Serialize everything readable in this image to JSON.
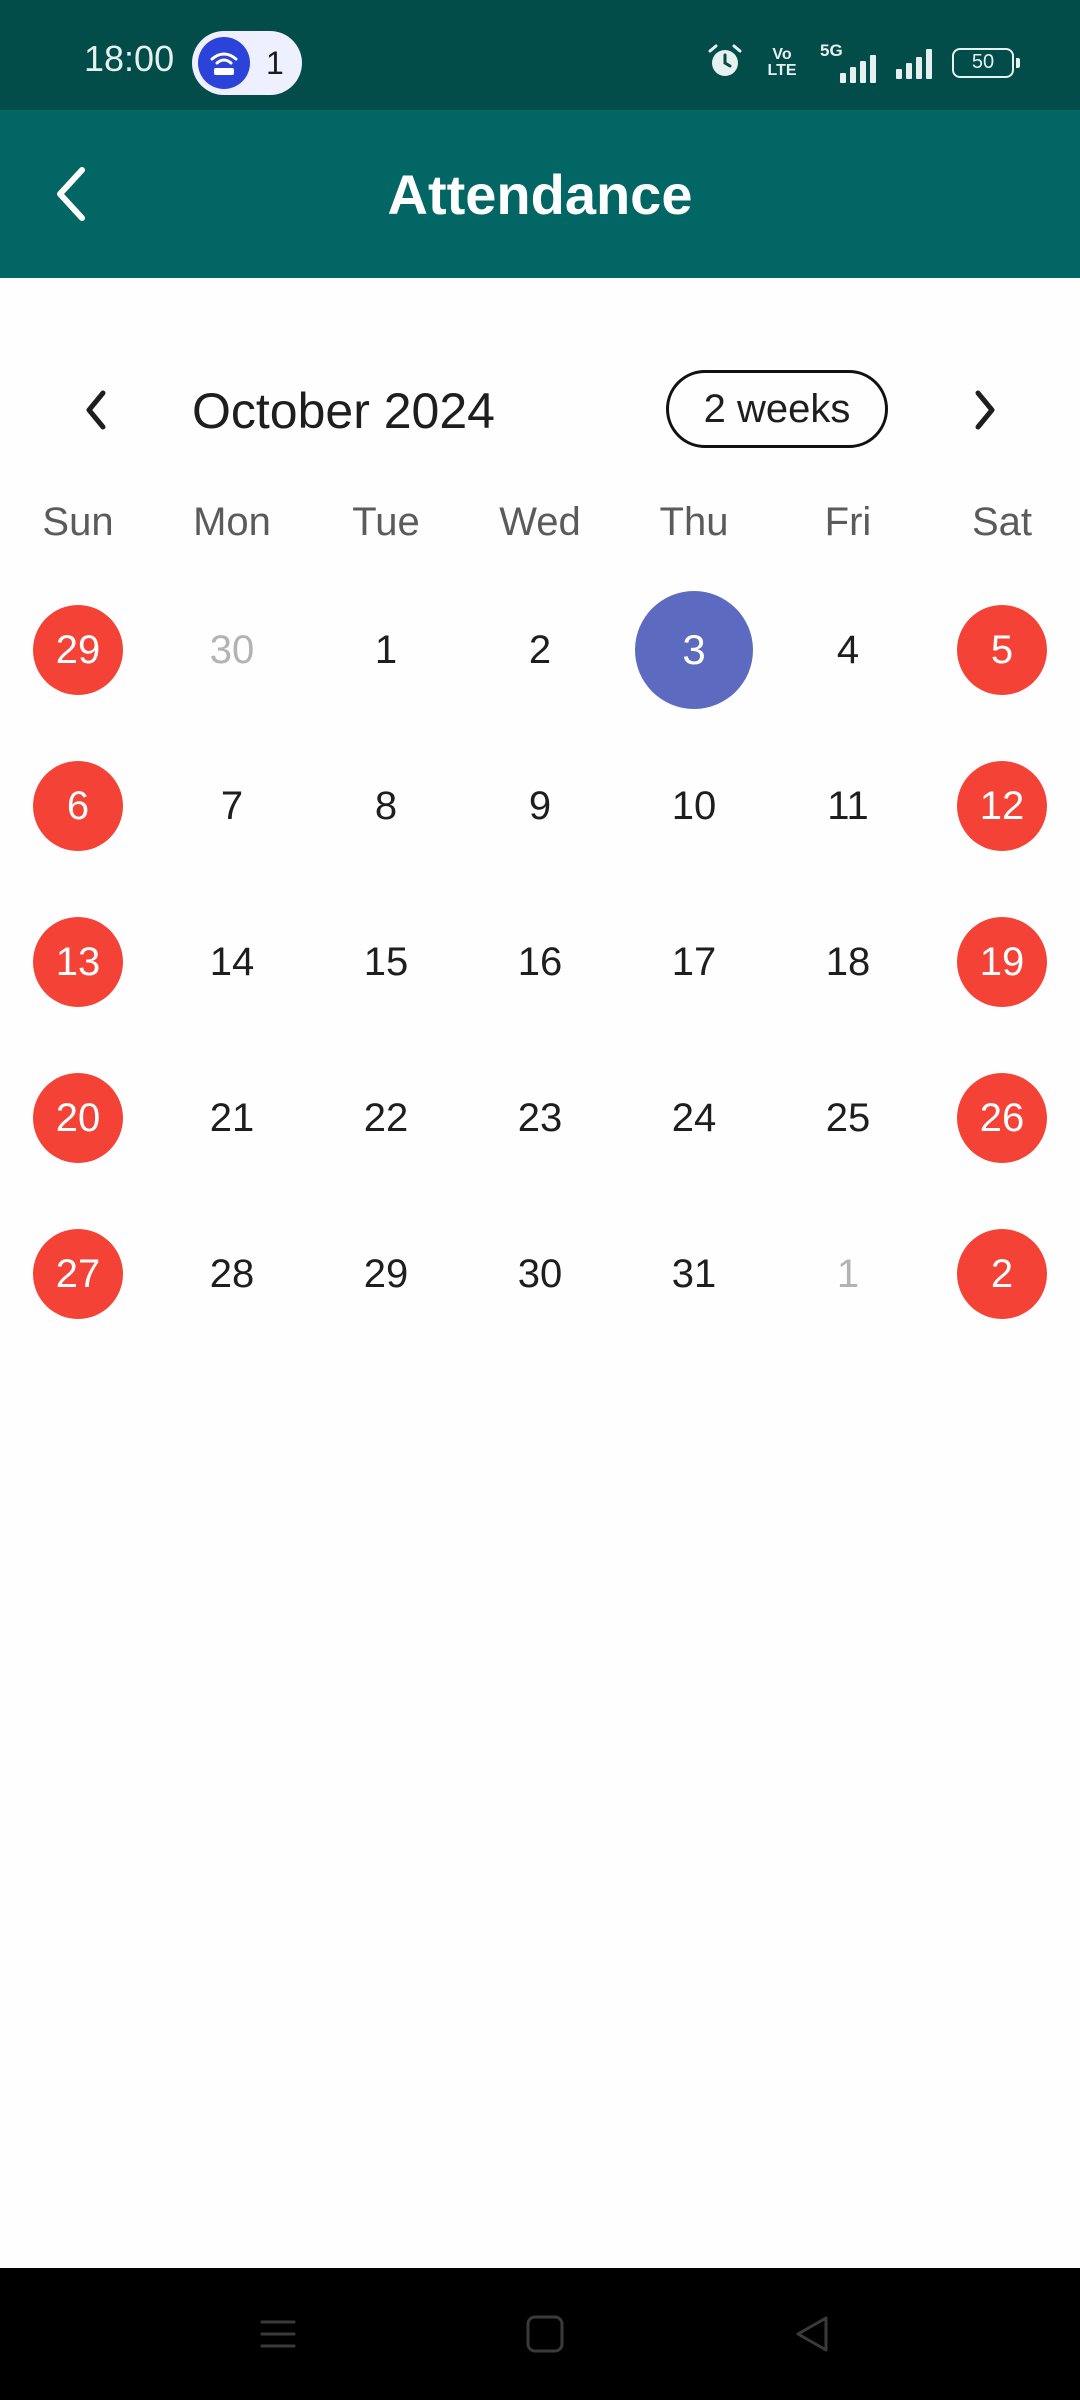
{
  "status_bar": {
    "time": "18:00",
    "hotspot_count": "1",
    "volte_top": "Vo",
    "volte_bottom": "LTE",
    "network_type": "5G",
    "battery": "50",
    "icons": [
      "hotspot-icon",
      "alarm-icon",
      "volte-icon",
      "signal-5g-icon",
      "signal-icon",
      "battery-icon"
    ]
  },
  "app_bar": {
    "title": "Attendance",
    "back_icon": "chevron-left-icon"
  },
  "calendar": {
    "month_title": "October 2024",
    "format_button": "2 weeks",
    "weekdays": [
      "Sun",
      "Mon",
      "Tue",
      "Wed",
      "Thu",
      "Fri",
      "Sat"
    ],
    "weeks": [
      [
        {
          "label": "29",
          "state": "holiday"
        },
        {
          "label": "30",
          "state": "outside"
        },
        {
          "label": "1",
          "state": "normal"
        },
        {
          "label": "2",
          "state": "normal"
        },
        {
          "label": "3",
          "state": "selected"
        },
        {
          "label": "4",
          "state": "normal"
        },
        {
          "label": "5",
          "state": "holiday"
        }
      ],
      [
        {
          "label": "6",
          "state": "holiday"
        },
        {
          "label": "7",
          "state": "normal"
        },
        {
          "label": "8",
          "state": "normal"
        },
        {
          "label": "9",
          "state": "normal"
        },
        {
          "label": "10",
          "state": "normal"
        },
        {
          "label": "11",
          "state": "normal"
        },
        {
          "label": "12",
          "state": "holiday"
        }
      ],
      [
        {
          "label": "13",
          "state": "holiday"
        },
        {
          "label": "14",
          "state": "normal"
        },
        {
          "label": "15",
          "state": "normal"
        },
        {
          "label": "16",
          "state": "normal"
        },
        {
          "label": "17",
          "state": "normal"
        },
        {
          "label": "18",
          "state": "normal"
        },
        {
          "label": "19",
          "state": "holiday"
        }
      ],
      [
        {
          "label": "20",
          "state": "holiday"
        },
        {
          "label": "21",
          "state": "normal"
        },
        {
          "label": "22",
          "state": "normal"
        },
        {
          "label": "23",
          "state": "normal"
        },
        {
          "label": "24",
          "state": "normal"
        },
        {
          "label": "25",
          "state": "normal"
        },
        {
          "label": "26",
          "state": "holiday"
        }
      ],
      [
        {
          "label": "27",
          "state": "holiday"
        },
        {
          "label": "28",
          "state": "normal"
        },
        {
          "label": "29",
          "state": "normal"
        },
        {
          "label": "30",
          "state": "normal"
        },
        {
          "label": "31",
          "state": "normal"
        },
        {
          "label": "1",
          "state": "outside"
        },
        {
          "label": "2",
          "state": "holiday"
        }
      ]
    ]
  },
  "nav_bar": {
    "icons": [
      "menu-icon",
      "home-icon",
      "back-triangle-icon"
    ]
  },
  "colors": {
    "status_bar": "#024c4a",
    "app_bar": "#026764",
    "holiday": "#f44336",
    "selected": "#5c6bc0",
    "outside_text": "#b3b3b3"
  }
}
